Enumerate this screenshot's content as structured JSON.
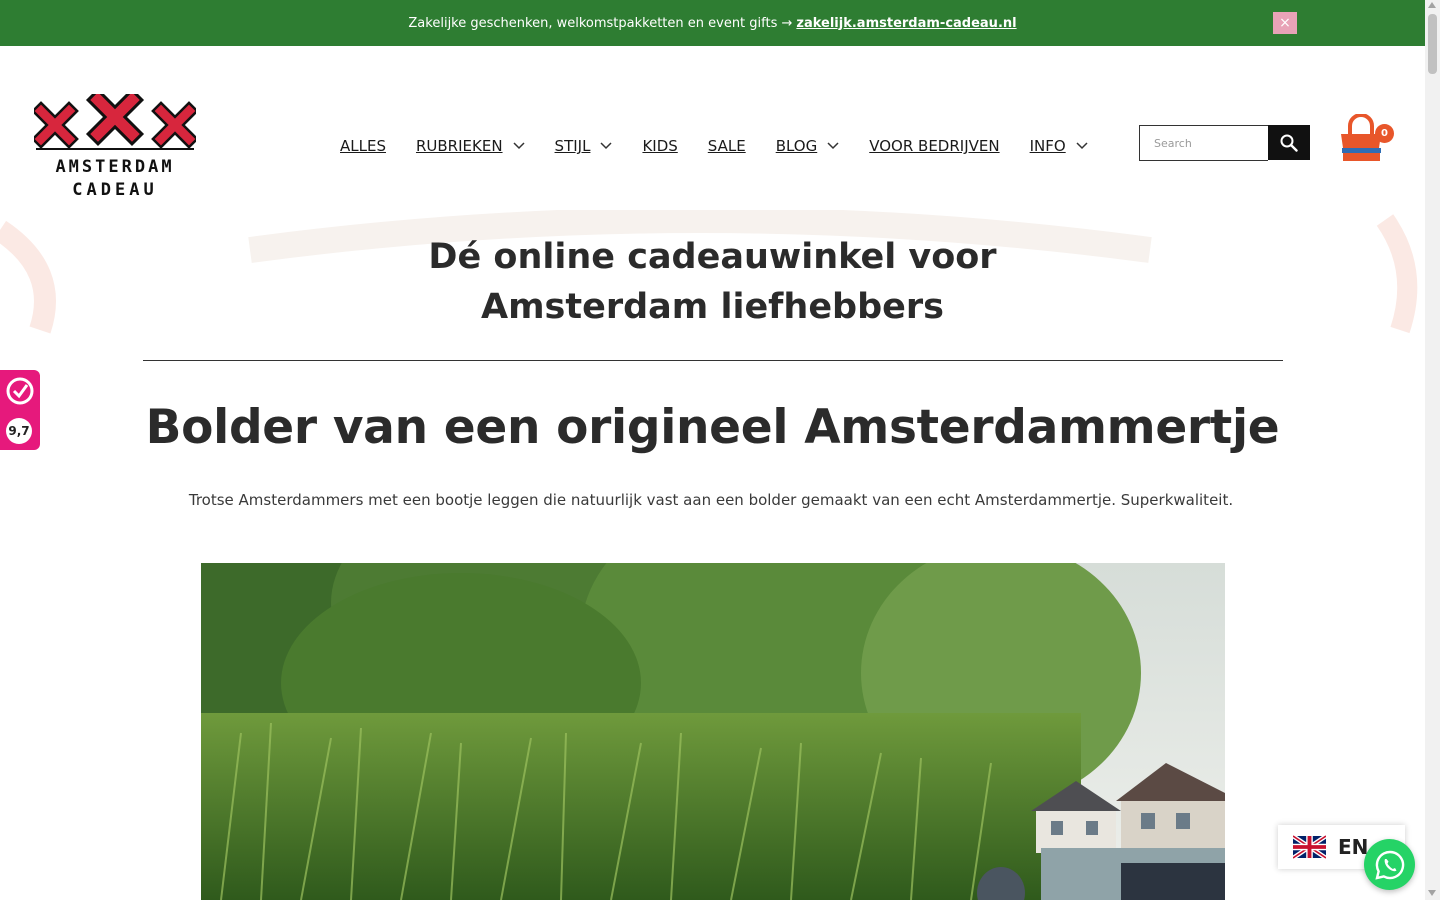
{
  "promo": {
    "text": "Zakelijke geschenken, welkomstpakketten en event gifts →",
    "link": "zakelijk.amsterdam-cadeau.nl",
    "close_label": "×"
  },
  "logo": {
    "line1": "AMSTERDAM",
    "line2": "CADEAU"
  },
  "nav": {
    "items": [
      {
        "label": "ALLES",
        "has_dropdown": false
      },
      {
        "label": "RUBRIEKEN",
        "has_dropdown": true
      },
      {
        "label": "STIJL",
        "has_dropdown": true
      },
      {
        "label": "KIDS",
        "has_dropdown": false
      },
      {
        "label": "SALE",
        "has_dropdown": false
      },
      {
        "label": "BLOG",
        "has_dropdown": true
      },
      {
        "label": "VOOR BEDRIJVEN",
        "has_dropdown": false
      },
      {
        "label": "INFO",
        "has_dropdown": true
      }
    ]
  },
  "search": {
    "placeholder": "Search",
    "icon": "search-icon"
  },
  "cart": {
    "count": "0",
    "icon": "shopping-bag-icon"
  },
  "main": {
    "tagline_line1": "Dé online cadeauwinkel voor",
    "tagline_line2": "Amsterdam liefhebbers",
    "title": "Bolder van een origineel Amsterdammertje",
    "intro": "Trotse Amsterdammers met een bootje leggen die natuurlijk vast aan een bolder gemaakt van een echt Amsterdammertje. Superkwaliteit."
  },
  "review_badge": {
    "score": "9,7",
    "icon": "kiyoh-icon"
  },
  "language": {
    "code": "EN",
    "icon": "uk-flag-icon"
  },
  "whatsapp": {
    "icon": "whatsapp-icon"
  },
  "colors": {
    "promo_bar": "#2e7d32",
    "close_button": "#e8a3b7",
    "logo_red": "#d7263d",
    "cart_orange": "#e8562a",
    "cart_blue": "#2f6db5",
    "review_pink": "#e6197c",
    "whatsapp_green": "#25d366"
  }
}
